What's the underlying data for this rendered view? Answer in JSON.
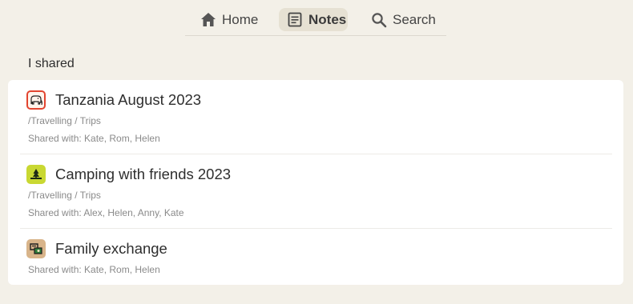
{
  "nav": {
    "tabs": [
      {
        "label": "Home",
        "icon": "home-icon",
        "active": false
      },
      {
        "label": "Notes",
        "icon": "notes-icon",
        "active": true
      },
      {
        "label": "Search",
        "icon": "search-icon",
        "active": false
      }
    ]
  },
  "section": {
    "title": "I shared"
  },
  "notes": [
    {
      "title": "Tanzania August 2023",
      "path": "/Travelling / Trips",
      "shared": "Shared with: Kate, Rom, Helen",
      "icon": "elephant-icon",
      "icon_bg": "#e2442f"
    },
    {
      "title": "Camping with friends 2023",
      "path": "/Travelling / Trips",
      "shared": "Shared with: Alex, Helen, Anny, Kate",
      "icon": "campfire-icon",
      "icon_bg": "#c9d832"
    },
    {
      "title": "Family exchange",
      "path": "",
      "shared": "Shared with: Kate, Rom, Helen",
      "icon": "exchange-icon",
      "icon_bg": "#d8b48a"
    }
  ],
  "colors": {
    "background": "#f3f0e8",
    "card": "#ffffff",
    "active_tab": "#e6e1d3"
  }
}
